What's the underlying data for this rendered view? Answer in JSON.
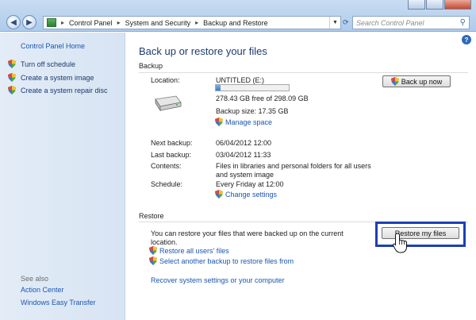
{
  "address": {
    "segments": [
      "Control Panel",
      "System and Security",
      "Backup and Restore"
    ],
    "search_placeholder": "Search Control Panel"
  },
  "left": {
    "home": "Control Panel Home",
    "tasks": [
      "Turn off schedule",
      "Create a system image",
      "Create a system repair disc"
    ],
    "see_also_label": "See also",
    "see_also": [
      "Action Center",
      "Windows Easy Transfer"
    ]
  },
  "main": {
    "title": "Back up or restore your files",
    "backup_header": "Backup",
    "location_label": "Location:",
    "location_value": "UNTITLED (E:)",
    "free_space": "278.43 GB free of 298.09 GB",
    "used_fraction": 0.066,
    "backup_size": "Backup size: 17.35 GB",
    "manage_space": "Manage space",
    "backup_now": "Back up now",
    "next_backup_label": "Next backup:",
    "next_backup_value": "06/04/2012 12:00",
    "last_backup_label": "Last backup:",
    "last_backup_value": "03/04/2012 11:33",
    "contents_label": "Contents:",
    "contents_value_1": "Files in libraries and personal folders for all users",
    "contents_value_2": "and system image",
    "schedule_label": "Schedule:",
    "schedule_value": "Every Friday at 12:00",
    "change_settings": "Change settings",
    "restore_header": "Restore",
    "restore_text_1": "You can restore your files that were backed up on the current",
    "restore_text_2": "location.",
    "restore_my_files": "Restore my files",
    "restore_all_users": "Restore all users' files",
    "select_another": "Select another backup to restore files from",
    "recover_system": "Recover system settings or your computer"
  },
  "colors": {
    "highlight_box": "#1e3fb4",
    "link": "#1a56b0"
  }
}
